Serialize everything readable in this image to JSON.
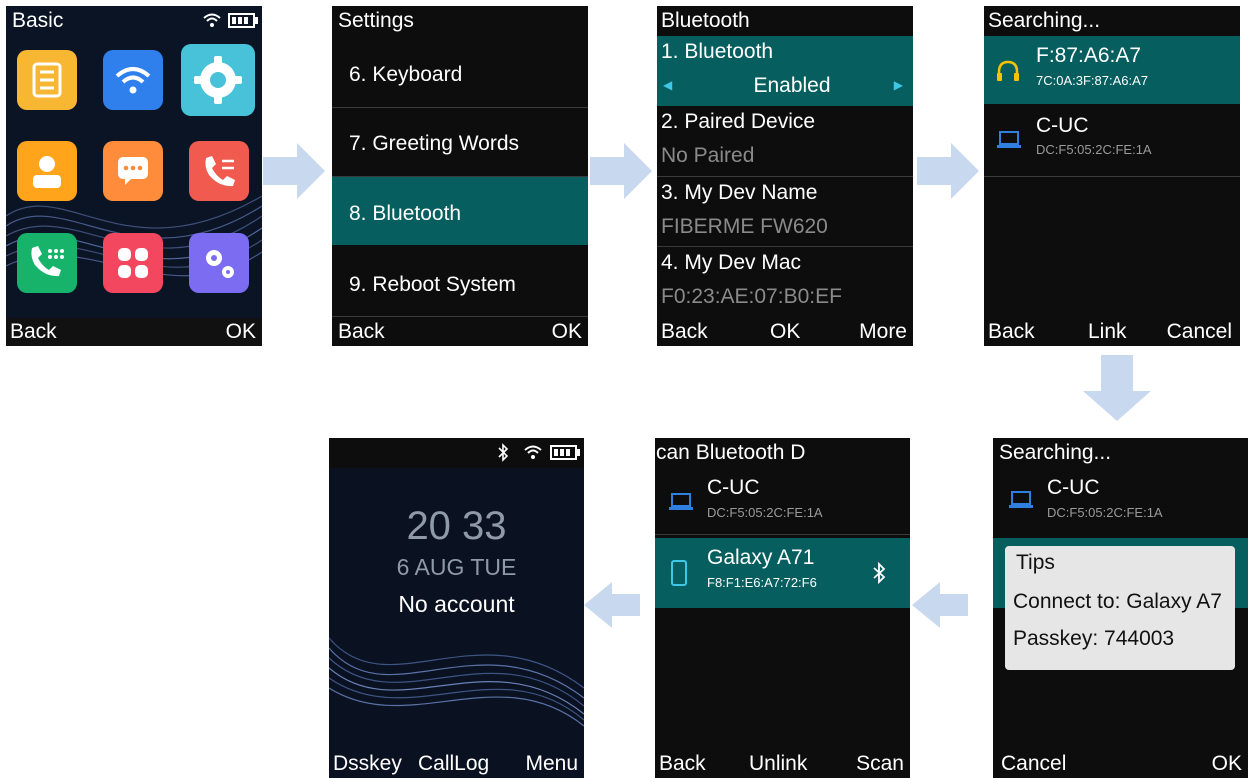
{
  "screen1": {
    "title": "Basic",
    "back": "Back",
    "ok": "OK",
    "app_icons": [
      "notes-icon",
      "wifi-icon",
      "settings-gear-icon",
      "contacts-icon",
      "messages-icon",
      "call-forward-icon",
      "dialer-icon",
      "apps-grid-icon",
      "advanced-settings-icon"
    ],
    "colors": {
      "yellow": "#f7b733",
      "blue": "#2f80ed",
      "cyan": "#47c2d9",
      "orange": "#ff7b2d",
      "red": "#f05a4f",
      "green": "#17b36b",
      "pink": "#f3465f",
      "purple": "#7c6cf2"
    }
  },
  "screen2": {
    "title": "Settings",
    "back": "Back",
    "ok": "OK",
    "items": [
      "6. Keyboard",
      "7. Greeting Words",
      "8. Bluetooth",
      "9. Reboot System"
    ]
  },
  "screen3": {
    "title": "Bluetooth",
    "back": "Back",
    "ok": "OK",
    "more": "More",
    "bt_label": "1. Bluetooth",
    "bt_value": "Enabled",
    "paired_label": "2. Paired Device",
    "paired_value": "No Paired",
    "name_label": "3. My Dev Name",
    "name_value": "FIBERME FW620",
    "mac_label": "4. My Dev Mac",
    "mac_value": "F0:23:AE:07:B0:EF"
  },
  "screen4": {
    "title": "Searching...",
    "back": "Back",
    "link": "Link",
    "cancel": "Cancel",
    "devices": [
      {
        "name": "F:87:A6:A7",
        "mac": "7C:0A:3F:87:A6:A7",
        "icon": "headphones-icon"
      },
      {
        "name": "C-UC",
        "mac": "DC:F5:05:2C:FE:1A",
        "icon": "laptop-icon"
      }
    ]
  },
  "screen5": {
    "title": "Searching...",
    "cancel": "Cancel",
    "ok": "OK",
    "device_name": "C-UC",
    "device_mac": "DC:F5:05:2C:FE:1A",
    "tips_title": "Tips",
    "tips_connect": "Connect to: Galaxy A7",
    "tips_passkey": "Passkey: 744003"
  },
  "screen6": {
    "title": "can Bluetooth D",
    "back": "Back",
    "unlink": "Unlink",
    "scan": "Scan",
    "devices": [
      {
        "name": "C-UC",
        "mac": "DC:F5:05:2C:FE:1A",
        "icon": "laptop-icon"
      },
      {
        "name": "Galaxy A71",
        "mac": "F8:F1:E6:A7:72:F6",
        "icon": "phone-icon"
      }
    ]
  },
  "screen7": {
    "time": "20 33",
    "date": "6 AUG TUE",
    "account": "No account",
    "dsskey": "Dsskey",
    "calllog": "CallLog",
    "menu": "Menu"
  }
}
